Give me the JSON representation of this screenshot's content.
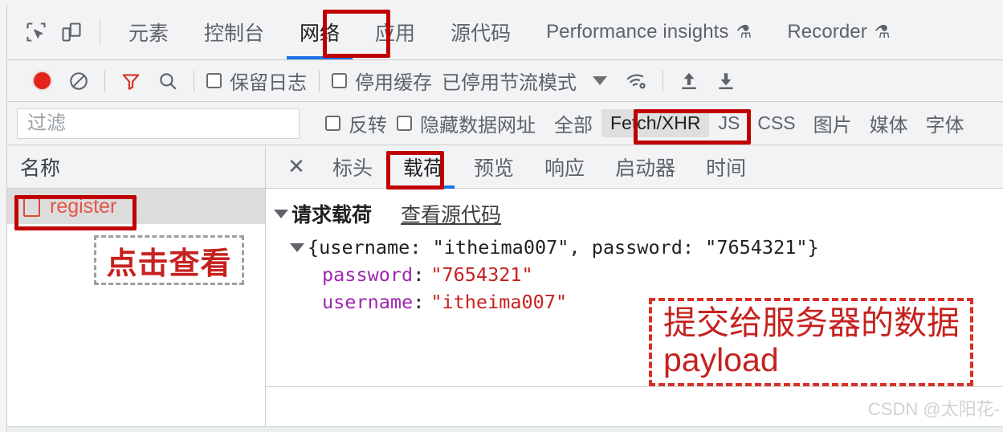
{
  "devtools": {
    "tabbar": {
      "inspect_icon": "inspect-element-icon",
      "device_icon": "device-toolbar-icon",
      "tabs": [
        {
          "label": "元素",
          "active": false,
          "flask": false
        },
        {
          "label": "控制台",
          "active": false,
          "flask": false
        },
        {
          "label": "网络",
          "active": true,
          "flask": false
        },
        {
          "label": "应用",
          "active": false,
          "flask": false
        },
        {
          "label": "源代码",
          "active": false,
          "flask": false
        },
        {
          "label": "Performance insights",
          "active": false,
          "flask": true
        },
        {
          "label": "Recorder",
          "active": false,
          "flask": true
        }
      ],
      "flask_glyph": "⚗"
    },
    "toolbar": {
      "record_icon": "record-dot-icon",
      "clear_icon": "clear-icon",
      "filter_icon": "filter-funnel-icon",
      "search_icon": "search-icon",
      "preserve_log_label": "保留日志",
      "disable_cache_label": "停用缓存",
      "throttling_label": "已停用节流模式",
      "caret_icon": "chevron-down-icon",
      "network_conditions_icon": "wifi-gear-icon",
      "import_icon": "upload-arrow-icon",
      "export_icon": "download-arrow-icon"
    },
    "filterbar": {
      "filter_placeholder": "过滤",
      "filter_value": "",
      "invert_label": "反转",
      "hide_data_urls_label": "隐藏数据网址",
      "types": [
        {
          "label": "全部",
          "selected": false
        },
        {
          "label": "Fetch/XHR",
          "selected": true
        },
        {
          "label": "JS",
          "selected": false
        },
        {
          "label": "CSS",
          "selected": false
        },
        {
          "label": "图片",
          "selected": false
        },
        {
          "label": "媒体",
          "selected": false
        },
        {
          "label": "字体",
          "selected": false
        }
      ]
    },
    "sidebar": {
      "column_header": "名称",
      "requests": [
        {
          "name": "register",
          "icon": "document-icon",
          "selected": true
        }
      ]
    },
    "panel": {
      "close_icon": "close-icon",
      "tabs": [
        {
          "label": "标头",
          "active": false
        },
        {
          "label": "载荷",
          "active": true
        },
        {
          "label": "预览",
          "active": false
        },
        {
          "label": "响应",
          "active": false
        },
        {
          "label": "启动器",
          "active": false
        },
        {
          "label": "时间",
          "active": false
        }
      ],
      "payload": {
        "section_title": "请求载荷",
        "view_source_label": "查看源代码",
        "object_summary": "{username: \"itheima007\", password: \"7654321\"}",
        "properties": [
          {
            "key": "password",
            "colon": ":",
            "value": "\"7654321\""
          },
          {
            "key": "username",
            "colon": ":",
            "value": "\"itheima007\""
          }
        ]
      }
    }
  },
  "annotations": {
    "click_to_view": "点击查看",
    "payload_note_line1": "提交给服务器的数据",
    "payload_note_line2": "payload",
    "box_color": "#c00000",
    "dashed_red_color": "#d93025",
    "dashed_gray_color": "#9e9e9e",
    "text_color": "#c5221f"
  },
  "watermark": "CSDN @太阳花-"
}
